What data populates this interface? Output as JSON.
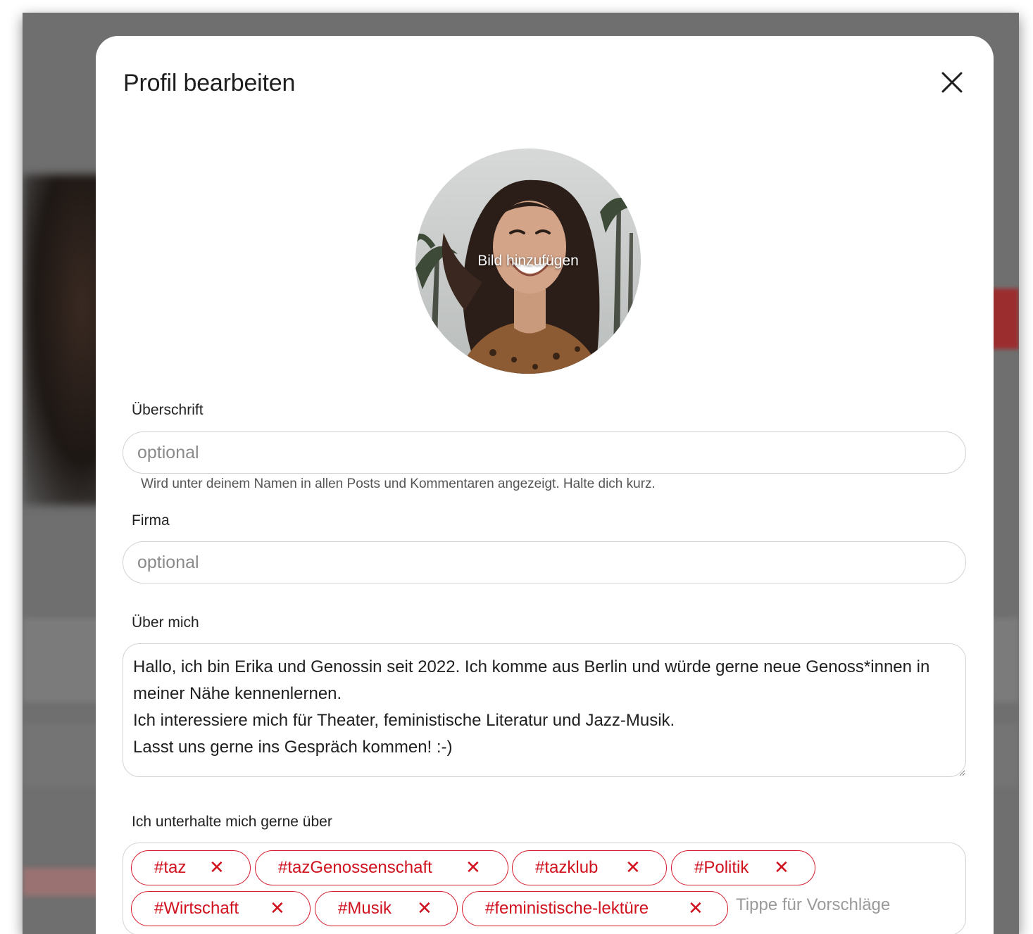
{
  "modal": {
    "title": "Profil bearbeiten",
    "close_icon": "close-icon"
  },
  "avatar": {
    "label": "Bild hinzufügen"
  },
  "headline": {
    "label": "Überschrift",
    "placeholder": "optional",
    "value": "",
    "hint": "Wird unter deinem Namen in allen Posts und Kommentaren angezeigt. Halte dich kurz."
  },
  "company": {
    "label": "Firma",
    "placeholder": "optional",
    "value": ""
  },
  "about": {
    "label": "Über mich",
    "value": "Hallo, ich bin Erika und Genossin seit 2022. Ich komme aus Berlin und würde gerne neue Genoss*innen in meiner Nähe kennenlernen.\nIch interessiere mich für Theater, feministische Literatur und Jazz-Musik.\nLasst uns gerne ins Gespräch kommen! :-)"
  },
  "topics": {
    "label": "Ich unterhalte mich gerne über",
    "tags": [
      {
        "label": "#taz",
        "remove": "✕"
      },
      {
        "label": "#tazGenossenschaft",
        "remove": "✕"
      },
      {
        "label": "#tazklub",
        "remove": "✕"
      },
      {
        "label": "#Politik",
        "remove": "✕"
      },
      {
        "label": "#Wirtschaft",
        "remove": "✕"
      },
      {
        "label": "#Musik",
        "remove": "✕"
      },
      {
        "label": "#feministische-lektüre",
        "remove": "✕"
      }
    ],
    "input_placeholder": "Tippe für Vorschläge"
  },
  "colors": {
    "accent": "#d51a2a",
    "overlay": "#6f6f6f",
    "border": "#d3d3d3"
  }
}
